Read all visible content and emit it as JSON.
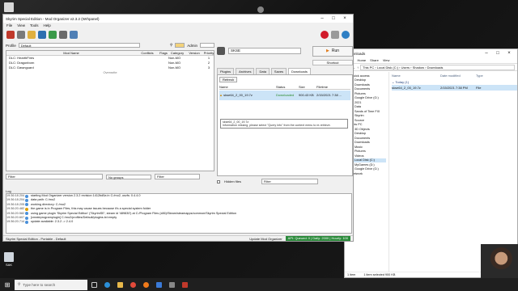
{
  "desktop": {
    "icons": [
      {
        "label": "Recycle Bin"
      },
      {
        "label": ""
      },
      {
        "label": "SAK"
      }
    ]
  },
  "mo2": {
    "title": "Skyrim Special Edition - Mod Organizer v2.3.2 (Wrhpanel)",
    "menu": [
      "File",
      "View",
      "Tools",
      "Help"
    ],
    "profile_label": "Profile",
    "profile_value": "Default",
    "admin_label": "Admin",
    "mod_columns": [
      "Mod Name",
      "Conflicts",
      "Flags",
      "Category",
      "Version",
      "Priority"
    ],
    "mods": [
      {
        "name": "DLC: HearthFires",
        "category": "Non-MO",
        "priority": "1"
      },
      {
        "name": "DLC: Dragonborn",
        "category": "Non-MO",
        "priority": "2"
      },
      {
        "name": "DLC: Dawnguard",
        "category": "Non-MO",
        "priority": "3"
      }
    ],
    "overwrite_label": "Overwrite",
    "filter_placeholder": "Filter",
    "groups_value": "No groups",
    "filter2_placeholder": "Filter",
    "game": "SKSE",
    "run_label": "Run",
    "shortcut_label": "Shortcut",
    "tabs": [
      "Plugins",
      "Archives",
      "Data",
      "Saves",
      "Downloads"
    ],
    "refresh_label": "Refresh",
    "download_columns": [
      "Name",
      "Status",
      "Size",
      "Filetime"
    ],
    "download": {
      "name": "skse64_2_00_19.7z",
      "status": "Downloaded",
      "size": "900.43 KB",
      "filetime": "2/15/2021 7:38 ..."
    },
    "tooltip_lines": [
      "skse64_2_00_19.7z",
      "Information missing, please select \"Query Info\" from the context menu to re-retrieve."
    ],
    "hidden_files_label": "Hidden files",
    "dl_filter_placeholder": "Filter",
    "log_label": "Log",
    "log": [
      {
        "ts": "19:36:18.204",
        "lvl": "i",
        "msg": "starting Mod Organizer version 2.3.2 revision 1412bd5a in C:/mo2, usvfs: 0.4.4.0"
      },
      {
        "ts": "19:36:18.204",
        "lvl": "i",
        "msg": "data path: C:/mo2"
      },
      {
        "ts": "19:36:18.205",
        "lvl": "i",
        "msg": "working directory: C:/mo2"
      },
      {
        "ts": "19:36:20.482",
        "lvl": "w",
        "msg": "the game is in Program Files, this may cause issues because it's a special system folder"
      },
      {
        "ts": "19:36:20.582",
        "lvl": "i",
        "msg": "using game plugin 'Skyrim Special Edition' ('SkyrimSE', steam id '489830') at C:/Program Files (x86)/Steam/steamapps/common/Skyrim Special Edition"
      },
      {
        "ts": "19:36:20.607",
        "lvl": "i",
        "msg": "[createprogramplugin] C:/mo2/profiles/Default/plugins.txt empty"
      },
      {
        "ts": "19:36:20.714",
        "lvl": "i",
        "msg": "update available: 2.3.2 -> 2.4.0"
      }
    ],
    "status_left": "Skyrim Special Edition - Portable - Default",
    "status_update": "Update Mod Organizer",
    "status_api": "API: Queued: 0 | Daily: 2000 | Hourly: 100"
  },
  "explorer": {
    "title": "Downloads",
    "ribbon": [
      "File",
      "Home",
      "Share",
      "View"
    ],
    "address": [
      "This PC",
      "Local Disk (C:)",
      "Users",
      "Shadow",
      "Downloads"
    ],
    "search_placeholder": "Search Downloads",
    "nav": [
      {
        "label": "Quick access",
        "sub": false
      },
      {
        "label": "Desktop",
        "sub": true
      },
      {
        "label": "Downloads",
        "sub": true
      },
      {
        "label": "Documents",
        "sub": true
      },
      {
        "label": "Pictures",
        "sub": true
      },
      {
        "label": "Google Drive (G:)",
        "sub": true
      },
      {
        "label": "2021",
        "sub": true
      },
      {
        "label": "Data",
        "sub": true
      },
      {
        "label": "Sands of Time FIX",
        "sub": true
      },
      {
        "label": "Skyrim",
        "sub": true
      },
      {
        "label": "Source",
        "sub": true
      },
      {
        "label": "This PC",
        "sub": false
      },
      {
        "label": "3D Objects",
        "sub": true
      },
      {
        "label": "Desktop",
        "sub": true
      },
      {
        "label": "Documents",
        "sub": true
      },
      {
        "label": "Downloads",
        "sub": true
      },
      {
        "label": "Music",
        "sub": true
      },
      {
        "label": "Pictures",
        "sub": true
      },
      {
        "label": "Videos",
        "sub": true
      },
      {
        "label": "Local Disk (C:)",
        "sub": true
      },
      {
        "label": "MyGames (D:)",
        "sub": true
      },
      {
        "label": "Google Drive (G:)",
        "sub": true
      },
      {
        "label": "Network",
        "sub": false
      }
    ],
    "file_columns": [
      "Name",
      "Date modified",
      "Type"
    ],
    "group": "Today (1)",
    "file": {
      "name": "skse64_2_00_19.7z",
      "date": "2/15/2021 7:38 PM",
      "type": "File"
    },
    "status": [
      "1 item",
      "1 item selected  900 KB"
    ]
  },
  "taskbar": {
    "search_placeholder": "Type here to search",
    "apps": [
      "task-view",
      "edge",
      "explorer",
      "chrome",
      "firefox",
      "store",
      "settings",
      "mo2"
    ],
    "tray_time": ""
  }
}
